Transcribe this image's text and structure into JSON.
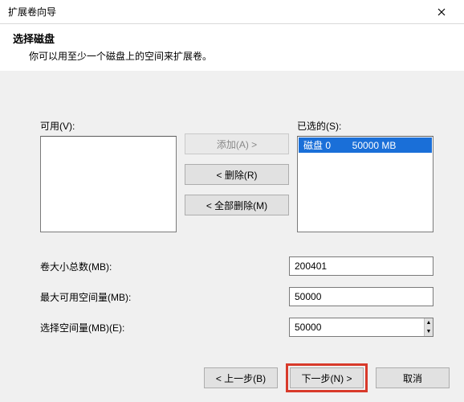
{
  "window": {
    "title": "扩展卷向导"
  },
  "header": {
    "heading": "选择磁盘",
    "description": "你可以用至少一个磁盘上的空间来扩展卷。"
  },
  "labels": {
    "available": "可用(V):",
    "selected": "已选的(S):",
    "add": "添加(A) >",
    "remove": "< 删除(R)",
    "remove_all": "< 全部删除(M)",
    "total_size": "卷大小总数(MB):",
    "max_space": "最大可用空间量(MB):",
    "select_space": "选择空间量(MB)(E):",
    "back": "< 上一步(B)",
    "next": "下一步(N) >",
    "cancel": "取消"
  },
  "lists": {
    "available_items": [],
    "selected_items": [
      {
        "text": "磁盘 0        50000 MB",
        "selected": true
      }
    ]
  },
  "values": {
    "total_size": "200401",
    "max_space": "50000",
    "select_space": "50000"
  }
}
